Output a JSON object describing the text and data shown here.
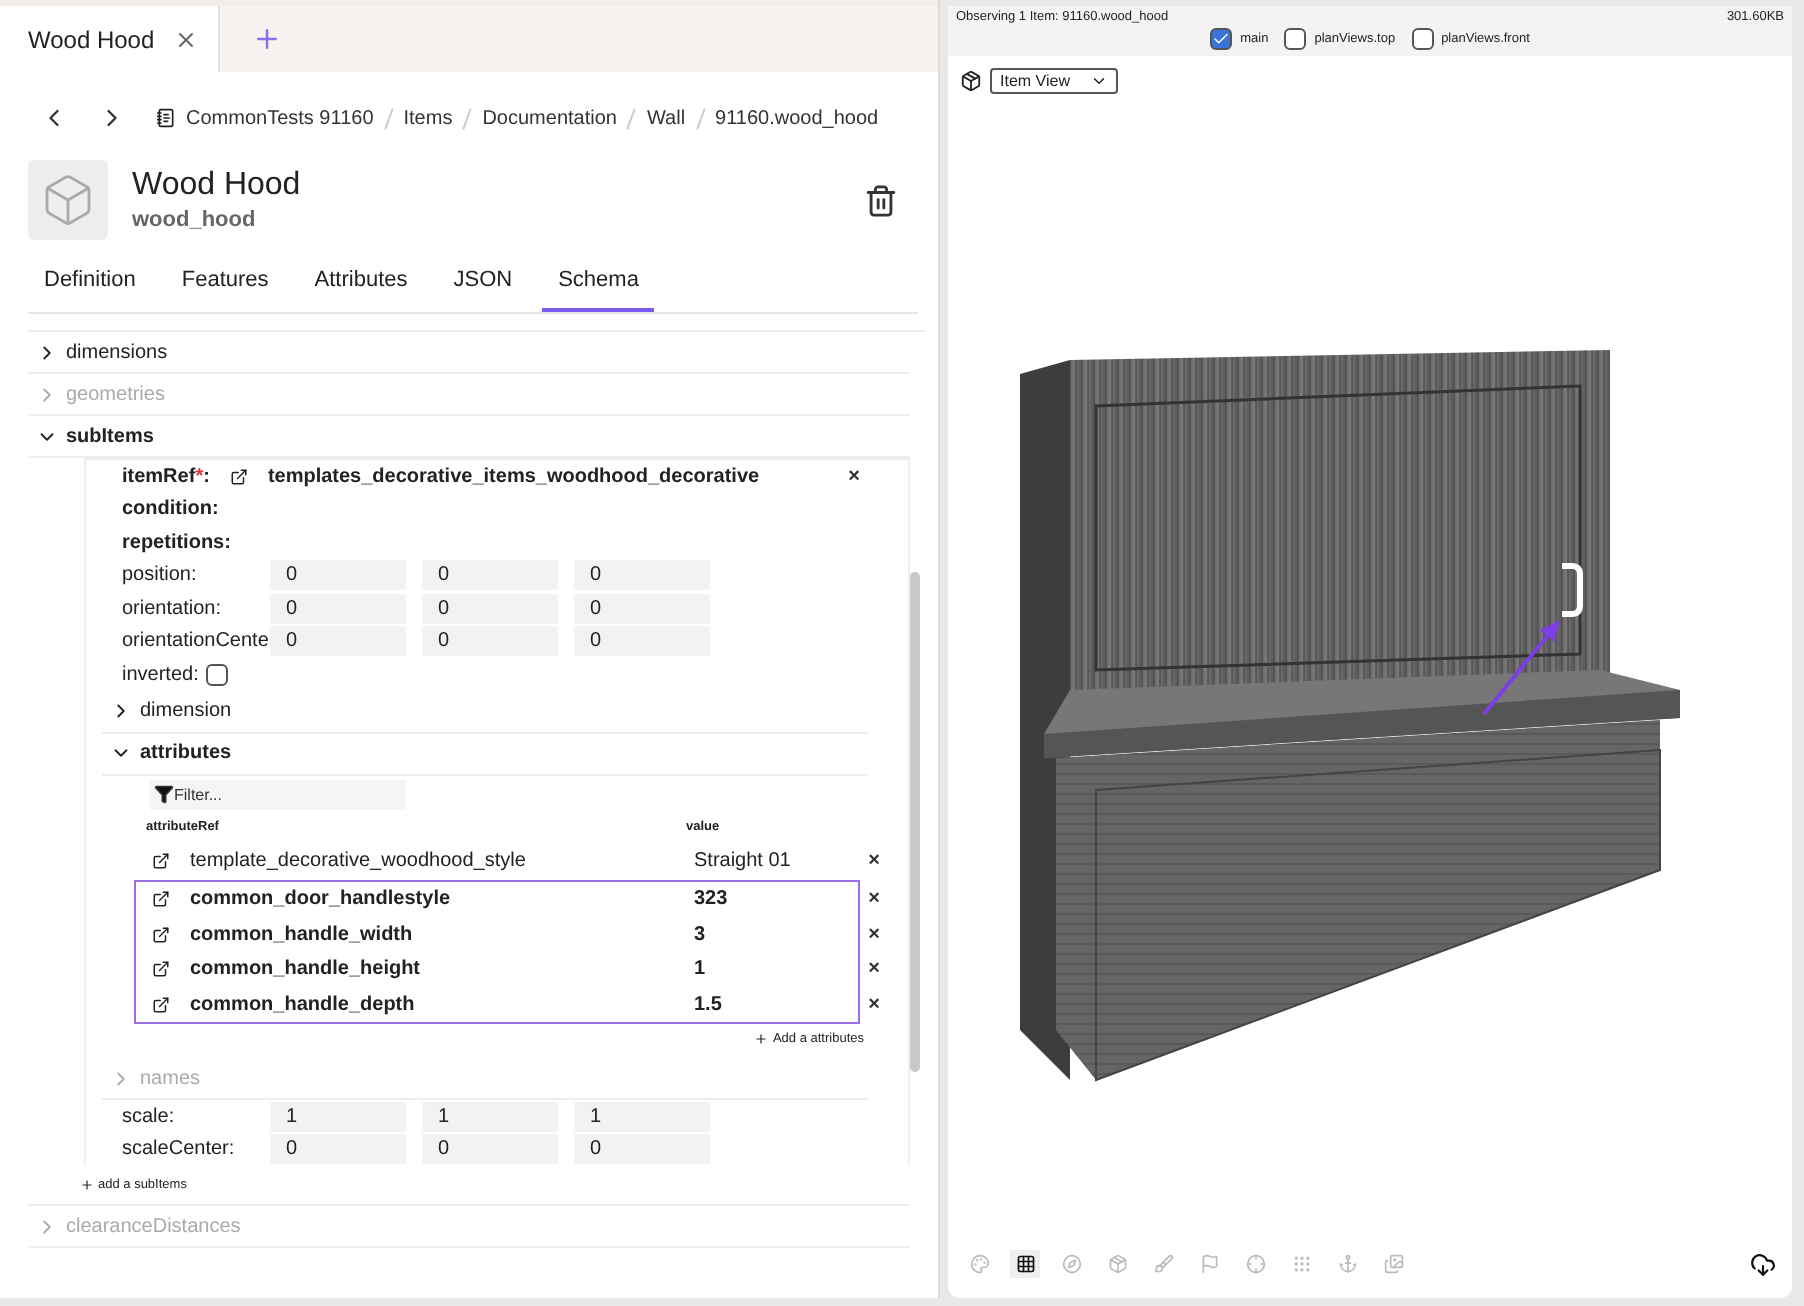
{
  "doc_tabs": [
    {
      "title": "Wood Hood",
      "selected": true
    }
  ],
  "breadcrumb": [
    "CommonTests 91160",
    "Items",
    "Documentation",
    "Wall",
    "91160.wood_hood"
  ],
  "item": {
    "title": "Wood Hood",
    "subtitle": "wood_hood"
  },
  "tabs": [
    {
      "label": "Definition",
      "selected": false
    },
    {
      "label": "Features",
      "selected": false
    },
    {
      "label": "Attributes",
      "selected": false
    },
    {
      "label": "JSON",
      "selected": false
    },
    {
      "label": "Schema",
      "selected": true
    }
  ],
  "schema_sections": [
    {
      "label": "dimensions",
      "expanded": false,
      "disabled": false
    },
    {
      "label": "geometries",
      "expanded": false,
      "disabled": true
    },
    {
      "label": "subItems",
      "expanded": true,
      "disabled": false
    },
    {
      "label": "clearanceDistances",
      "expanded": false,
      "disabled": true
    }
  ],
  "sub_item": {
    "item_ref": {
      "label": "itemRef",
      "required_mark": "*",
      "separator": ":",
      "value": "templates_decorative_items_woodhood_decorative",
      "remove": "×"
    },
    "labels": [
      "condition:",
      "repetitions:"
    ],
    "vectors": [
      {
        "label": "position:",
        "values": [
          "0",
          "0",
          "0"
        ]
      },
      {
        "label": "orientation:",
        "values": [
          "0",
          "0",
          "0"
        ]
      },
      {
        "label": "orientationCente",
        "values": [
          "0",
          "0",
          "0"
        ]
      }
    ],
    "inverted": {
      "label": "inverted:",
      "checked": false
    },
    "dimension": {
      "label": "dimension",
      "expanded": false,
      "disabled": false
    },
    "attributes": {
      "label": "attributes",
      "expanded": true,
      "disabled": false,
      "filter_placeholder": "Filter...",
      "columns": [
        "attributeRef",
        "value"
      ],
      "rows": [
        {
          "name": "template_decorative_woodhood_style",
          "value": "Straight 01",
          "selected": false,
          "remove": "×"
        },
        {
          "name": "common_door_handlestyle",
          "value": "323",
          "selected": true,
          "remove": "×"
        },
        {
          "name": "common_handle_width",
          "value": "3",
          "selected": true,
          "remove": "×"
        },
        {
          "name": "common_handle_height",
          "value": "1",
          "selected": true,
          "remove": "×"
        },
        {
          "name": "common_handle_depth",
          "value": "1.5",
          "selected": true,
          "remove": "×"
        }
      ],
      "add_label": "Add a attributes"
    },
    "names": {
      "label": "names",
      "expanded": false,
      "disabled": true
    },
    "scale_vectors": [
      {
        "label": "scale:",
        "values": [
          "1",
          "1",
          "1"
        ]
      },
      {
        "label": "scaleCenter:",
        "values": [
          "0",
          "0",
          "0"
        ]
      }
    ]
  },
  "add_sub_items": "add a subItems",
  "viewer": {
    "status": "Observing 1 Item: 91160.wood_hood",
    "size": "301.60KB",
    "views": [
      {
        "label": "main",
        "checked": true
      },
      {
        "label": "planViews.top",
        "checked": false
      },
      {
        "label": "planViews.front",
        "checked": false
      }
    ],
    "view_select": "Item View",
    "tools": [
      {
        "selected": false
      },
      {
        "selected": true
      },
      {
        "selected": false
      },
      {
        "selected": false
      },
      {
        "selected": false
      },
      {
        "selected": false
      },
      {
        "selected": false
      },
      {
        "selected": false
      },
      {
        "selected": false
      },
      {
        "selected": false
      }
    ]
  }
}
